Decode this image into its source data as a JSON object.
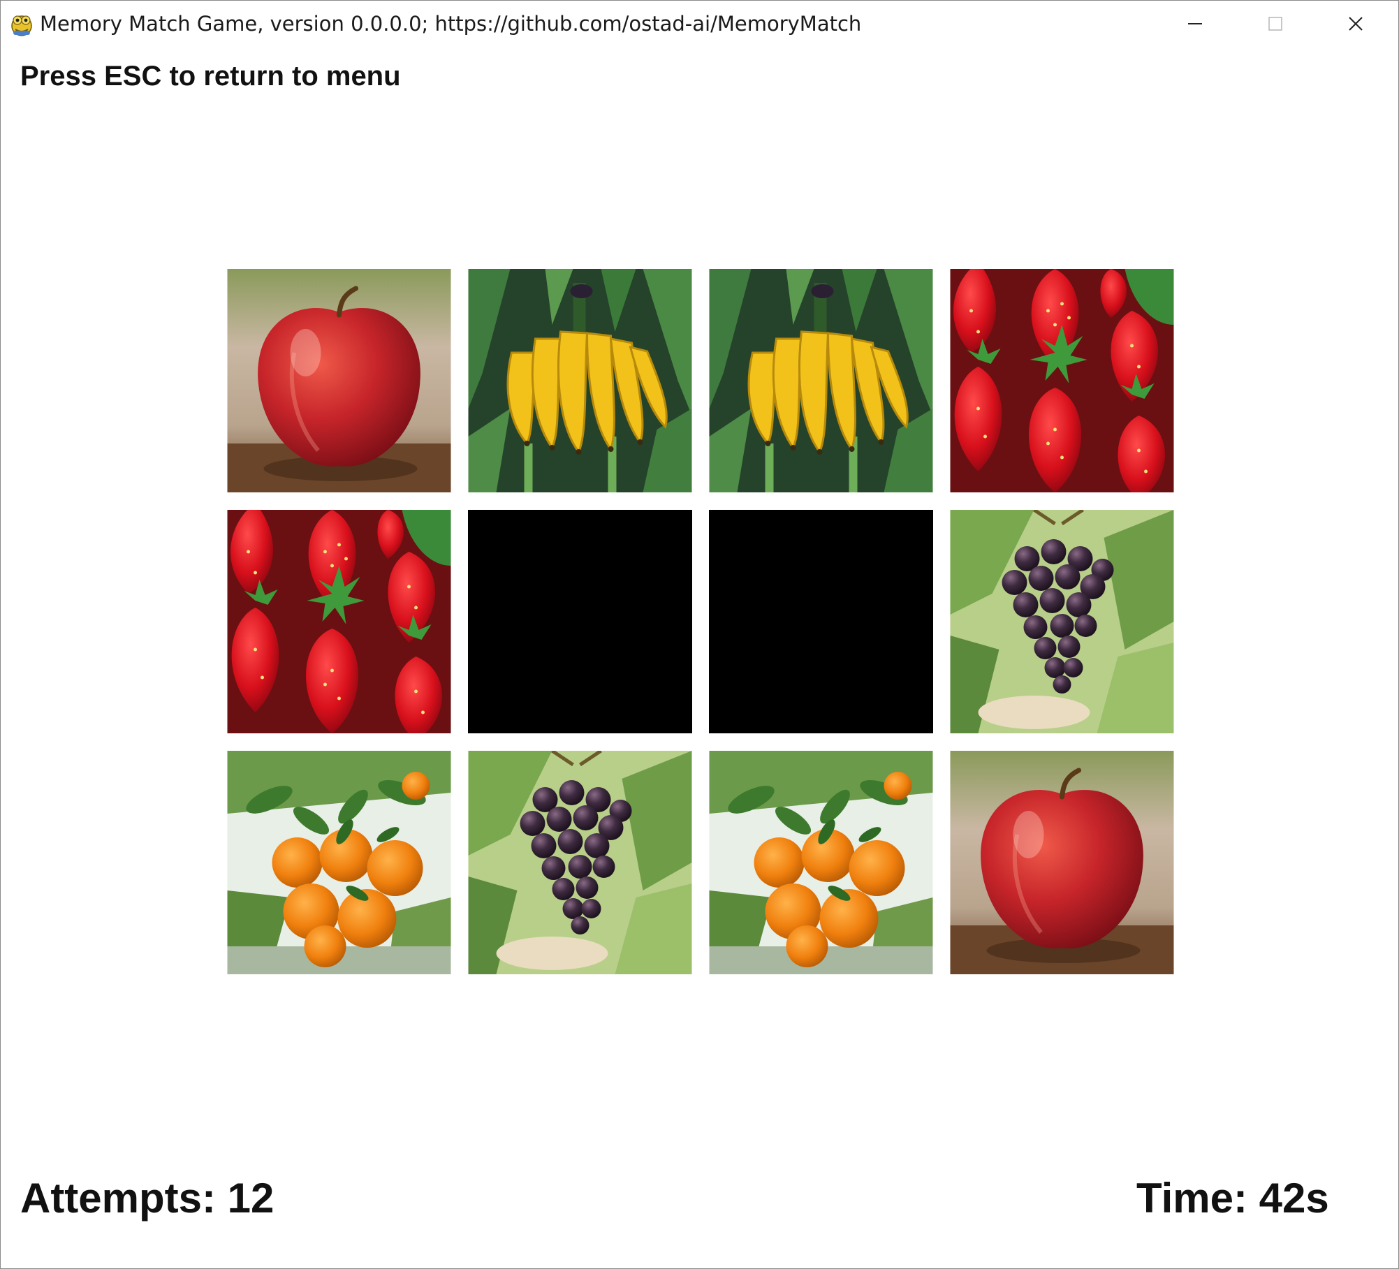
{
  "window": {
    "title": "Memory Match Game, version 0.0.0.0; https://github.com/ostad-ai/MemoryMatch",
    "icon": "pygame-snake-icon",
    "controls": [
      "minimize-icon",
      "maximize-icon",
      "close-icon"
    ]
  },
  "hint": "Press ESC to return to menu",
  "status": {
    "attempts": "Attempts: 12",
    "time": "Time: 42s"
  },
  "board": {
    "rows": 3,
    "cols": 4,
    "cards": [
      {
        "fruit": "apple",
        "state": "revealed"
      },
      {
        "fruit": "banana",
        "state": "revealed"
      },
      {
        "fruit": "banana",
        "state": "revealed"
      },
      {
        "fruit": "strawberry",
        "state": "revealed"
      },
      {
        "fruit": "strawberry",
        "state": "revealed"
      },
      {
        "fruit": "",
        "state": "hidden"
      },
      {
        "fruit": "",
        "state": "hidden"
      },
      {
        "fruit": "grapes",
        "state": "revealed"
      },
      {
        "fruit": "orange",
        "state": "revealed"
      },
      {
        "fruit": "grapes",
        "state": "revealed"
      },
      {
        "fruit": "orange",
        "state": "revealed"
      },
      {
        "fruit": "apple",
        "state": "revealed"
      }
    ]
  },
  "colors": {
    "background": "#ffffff",
    "hidden_card": "#000000",
    "text": "#111111"
  }
}
